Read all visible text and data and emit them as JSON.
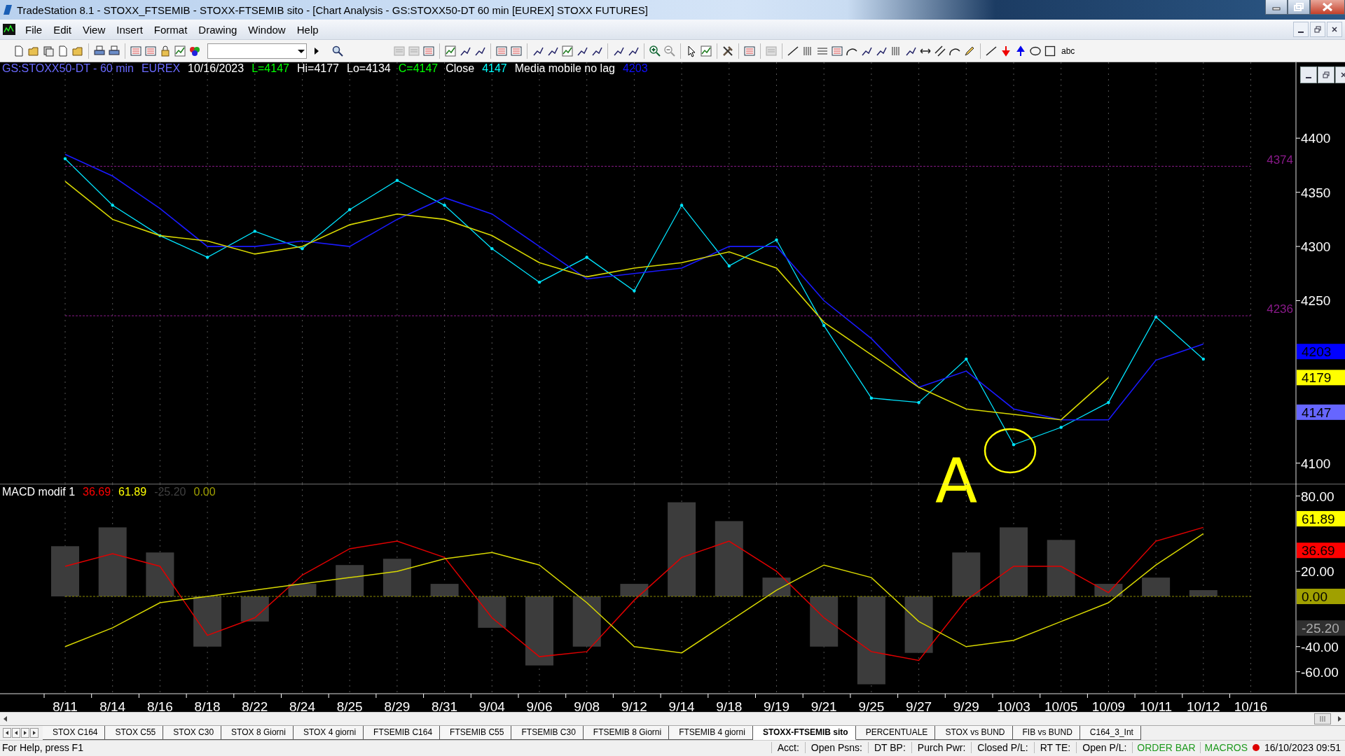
{
  "window": {
    "title": "TradeStation 8.1 - STOXX_FTSEMIB - STOXX-FTSEMIB sito - [Chart Analysis - GS:STOXX50-DT  60 min  [EUREX] STOXX FUTURES]"
  },
  "menu": [
    "File",
    "Edit",
    "View",
    "Insert",
    "Format",
    "Drawing",
    "Window",
    "Help"
  ],
  "toolbar": {
    "text_tool": "abc"
  },
  "price_pane": {
    "legend": [
      {
        "text": "GS:STOXX50-DT - 60 min",
        "color": "#6a6aff"
      },
      {
        "text": "EUREX",
        "color": "#6a6aff"
      },
      {
        "text": "10/16/2023",
        "color": "#ffffff"
      },
      {
        "text": "L=4147",
        "color": "#00ff00"
      },
      {
        "text": "Hi=4177",
        "color": "#ffffff"
      },
      {
        "text": "Lo=4134",
        "color": "#ffffff"
      },
      {
        "text": "C=4147",
        "color": "#00ff00"
      },
      {
        "text": "Close",
        "color": "#ffffff"
      },
      {
        "text": "4147",
        "color": "#00ffff"
      },
      {
        "text": "Media mobile no lag",
        "color": "#ffffff"
      },
      {
        "text": "4203",
        "color": "#1010ff"
      }
    ],
    "tags": [
      {
        "text": "4203",
        "color": "#0000ff"
      },
      {
        "text": "4179",
        "color": "#ffff00"
      },
      {
        "text": "4147",
        "color": "#6666ff"
      }
    ],
    "annotation": {
      "text": "A"
    },
    "chart_data": {
      "type": "line",
      "ylim": [
        4081,
        4470
      ],
      "yticks": [
        4100,
        4250,
        4300,
        4350,
        4400
      ],
      "grid": true,
      "series": [
        {
          "color": "#00e5ff",
          "values": [
            4381,
            4338,
            4310,
            4290,
            4314,
            4298,
            4334,
            4361,
            4338,
            4298,
            4267,
            4290,
            4259,
            4338,
            4282,
            4306,
            4227,
            4160,
            4156,
            4196,
            4117,
            4133,
            4156,
            4235,
            4196,
            null
          ]
        },
        {
          "color": "#1a1aff",
          "values": [
            4385,
            4365,
            4335,
            4300,
            4300,
            4305,
            4300,
            4325,
            4345,
            4330,
            4300,
            4270,
            4275,
            4280,
            4300,
            4300,
            4250,
            4215,
            4170,
            4185,
            4150,
            4140,
            4140,
            4195,
            4210,
            null
          ]
        },
        {
          "color": "#d8d800",
          "values": [
            4360,
            4325,
            4310,
            4305,
            4293,
            4300,
            4320,
            4330,
            4325,
            4310,
            4285,
            4272,
            4280,
            4285,
            4295,
            4280,
            4230,
            4200,
            4170,
            4150,
            4145,
            4140,
            4179,
            null,
            null,
            null
          ]
        },
        {
          "name": "4374",
          "color": "#8a1a8a",
          "line_style": "dashed",
          "values": [
            4374,
            4374,
            4374,
            4374,
            4374,
            4374,
            4374,
            4374,
            4374,
            4374,
            4374,
            4374,
            4374,
            4374,
            4374,
            4374,
            4374,
            4374,
            4374,
            4374,
            4374,
            4374,
            4374,
            4374,
            4374,
            4374
          ]
        },
        {
          "name": "4236",
          "color": "#8a1a8a",
          "line_style": "dashed",
          "values": [
            4236,
            4236,
            4236,
            4236,
            4236,
            4236,
            4236,
            4236,
            4236,
            4236,
            4236,
            4236,
            4236,
            4236,
            4236,
            4236,
            4236,
            4236,
            4236,
            4236,
            4236,
            4236,
            4236,
            4236,
            4236,
            4236
          ]
        }
      ]
    }
  },
  "macd_pane": {
    "legend": [
      {
        "text": "MACD modif 1",
        "color": "#ffffff"
      },
      {
        "text": "36.69",
        "color": "#ff0000"
      },
      {
        "text": "61.89",
        "color": "#ffff00"
      },
      {
        "text": "-25.20",
        "color": "#404040"
      },
      {
        "text": "0.00",
        "color": "#a0a000"
      }
    ],
    "tags": [
      {
        "text": "61.89",
        "color": "#ffff00"
      },
      {
        "text": "36.69",
        "color": "#ff0000"
      },
      {
        "text": "0.00",
        "color": "#a0a000"
      },
      {
        "text": "-25.20",
        "color": "#303030"
      }
    ],
    "chart_data": {
      "type": "line",
      "ylim": [
        -77.5,
        89.8
      ],
      "grid": true,
      "yticks": [
        {
          "value": -60,
          "label": "-60.00"
        },
        {
          "value": -40,
          "label": "-40.00"
        },
        {
          "value": 20,
          "label": "20.00"
        },
        {
          "value": 80,
          "label": "80.00"
        }
      ],
      "categories": [
        "8/11",
        "8/14",
        "8/16",
        "8/18",
        "8/22",
        "8/24",
        "8/25",
        "8/29",
        "8/31",
        "9/04",
        "9/06",
        "9/08",
        "9/12",
        "9/14",
        "9/18",
        "9/19",
        "9/21",
        "9/25",
        "9/27",
        "9/29",
        "10/03",
        "10/05",
        "10/09",
        "10/11",
        "10/12",
        "10/16"
      ],
      "series": [
        {
          "type": "bar",
          "color": "#3c3c3c",
          "values": [
            40,
            55,
            35,
            -40,
            -20,
            10,
            25,
            30,
            10,
            -25,
            -55,
            -40,
            10,
            75,
            60,
            15,
            -40,
            -70,
            -45,
            35,
            55,
            45,
            10,
            15,
            5,
            null
          ]
        },
        {
          "type": "line",
          "color": "#e00000",
          "values": [
            24,
            34,
            24,
            -31,
            -17,
            17,
            38,
            44,
            31,
            -17,
            -48,
            -44,
            -3,
            31,
            44,
            20,
            -17,
            -44,
            -51,
            -3,
            24,
            24,
            3,
            44,
            55,
            null
          ]
        },
        {
          "type": "line",
          "color": "#d8d800",
          "values": [
            -40,
            -25,
            -5,
            0,
            5,
            10,
            15,
            20,
            30,
            35,
            25,
            -5,
            -40,
            -45,
            -20,
            5,
            25,
            15,
            -20,
            -40,
            -35,
            -20,
            -5,
            25,
            50,
            null
          ]
        },
        {
          "type": "line",
          "color": "#8a8a00",
          "line_style": "dashed",
          "values": [
            0,
            0,
            0,
            0,
            0,
            0,
            0,
            0,
            0,
            0,
            0,
            0,
            0,
            0,
            0,
            0,
            0,
            0,
            0,
            0,
            0,
            0,
            0,
            0,
            0,
            0
          ]
        }
      ]
    }
  },
  "sheet_tabs": [
    {
      "label": "STOX C164",
      "selected": false
    },
    {
      "label": "STOX C55",
      "selected": false
    },
    {
      "label": "STOX  C30",
      "selected": false
    },
    {
      "label": "STOX  8 Giorni",
      "selected": false
    },
    {
      "label": "STOX 4 giorni",
      "selected": false
    },
    {
      "label": "FTSEMIB C164",
      "selected": false
    },
    {
      "label": "FTSEMIB C55",
      "selected": false
    },
    {
      "label": "FTSEMIB C30",
      "selected": false
    },
    {
      "label": "FTSEMIB  8 Giorni",
      "selected": false
    },
    {
      "label": "FTSEMIB  4 giorni",
      "selected": false
    },
    {
      "label": "STOXX-FTSEMIB sito",
      "selected": true
    },
    {
      "label": "PERCENTUALE",
      "selected": false
    },
    {
      "label": "STOX vs BUND",
      "selected": false
    },
    {
      "label": "FIB vs BUND",
      "selected": false
    },
    {
      "label": "C164_3_Int",
      "selected": false
    }
  ],
  "status_bar": {
    "help": "For Help, press F1",
    "fields": [
      "Acct:",
      "Open Psns:",
      "DT BP:",
      "Purch Pwr:",
      "Closed P/L:",
      "RT TE:",
      "Open P/L:"
    ],
    "buttons": [
      "ORDER BAR",
      "MACROS"
    ],
    "time": "16/10/2023 09:51"
  }
}
